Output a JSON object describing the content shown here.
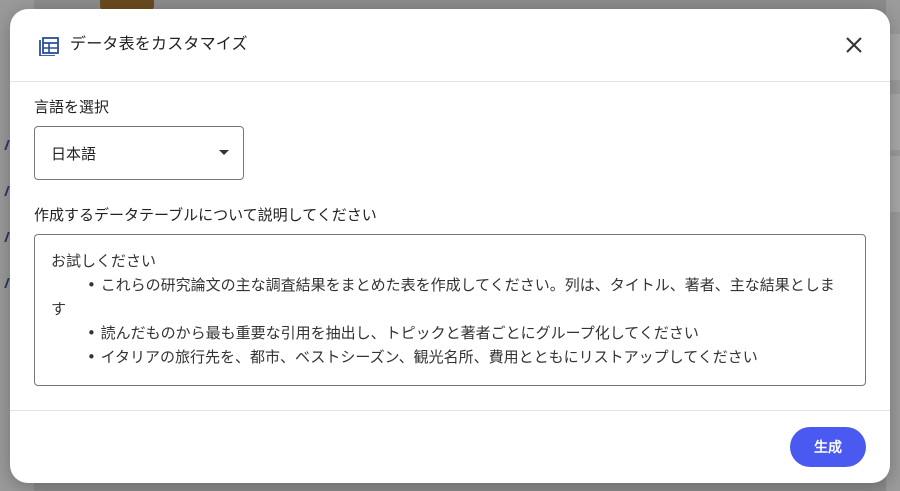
{
  "dialog": {
    "title": "データ表をカスタマイズ",
    "language_label": "言語を選択",
    "language_value": "日本語",
    "description_label": "作成するデータテーブルについて説明してください",
    "prompt": {
      "intro": "お試しください",
      "examples": [
        "• これらの研究論文の主な調査結果をまとめた表を作成してください。列は、タイトル、著者、主な結果とします",
        "• 読んだものから最も重要な引用を抽出し、トピックと著者ごとにグループ化してください",
        "• イタリアの旅行先を、都市、ベストシーズン、観光名所、費用とともにリストアップしてください"
      ]
    },
    "generate_label": "生成"
  },
  "colors": {
    "accent": "#4a5af0",
    "icon": "#2b4c9b"
  },
  "icons": {
    "header": "table-icon",
    "close": "close-icon",
    "dropdown": "caret-down-icon"
  }
}
